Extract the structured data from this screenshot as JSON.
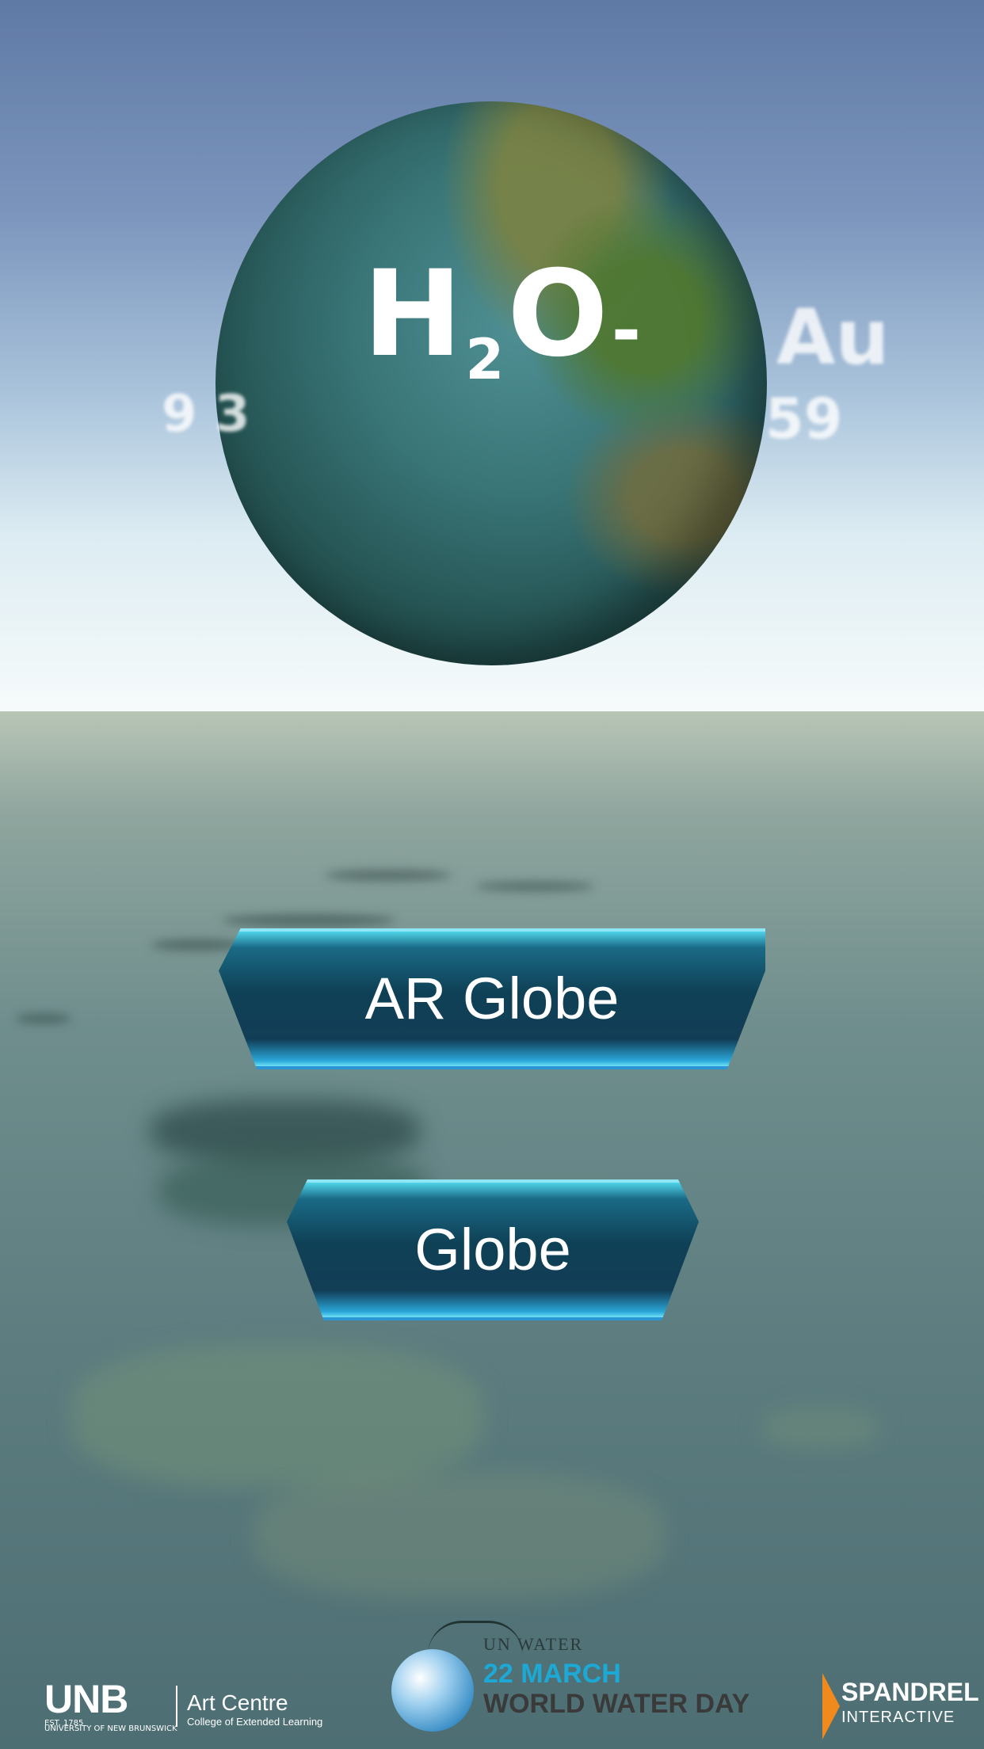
{
  "globe": {
    "title_main": "H",
    "title_sub": "2",
    "title_rest": "O",
    "title_dash": "-"
  },
  "ghost_text": {
    "left": "9 3",
    "right_top": "Au",
    "right_bottom": "59"
  },
  "buttons": {
    "ar_globe": "AR Globe",
    "globe": "Globe"
  },
  "footer": {
    "unb": {
      "mark": "UNB",
      "est": "EST. 1785",
      "university": "UNIVERSITY OF NEW BRUNSWICK"
    },
    "art_centre": {
      "title": "Art Centre",
      "subtitle": "College of Extended Learning"
    },
    "world_water_day": {
      "org": "UN WATER",
      "date": "22 MARCH",
      "name": "WORLD WATER DAY"
    },
    "spandrel": {
      "line1": "SPANDREL",
      "line2": "INTERACTIVE"
    }
  },
  "colors": {
    "accent_button": "#1a6a86",
    "date_blue": "#1ca9d6",
    "spandrel_orange": "#f08a1c"
  }
}
